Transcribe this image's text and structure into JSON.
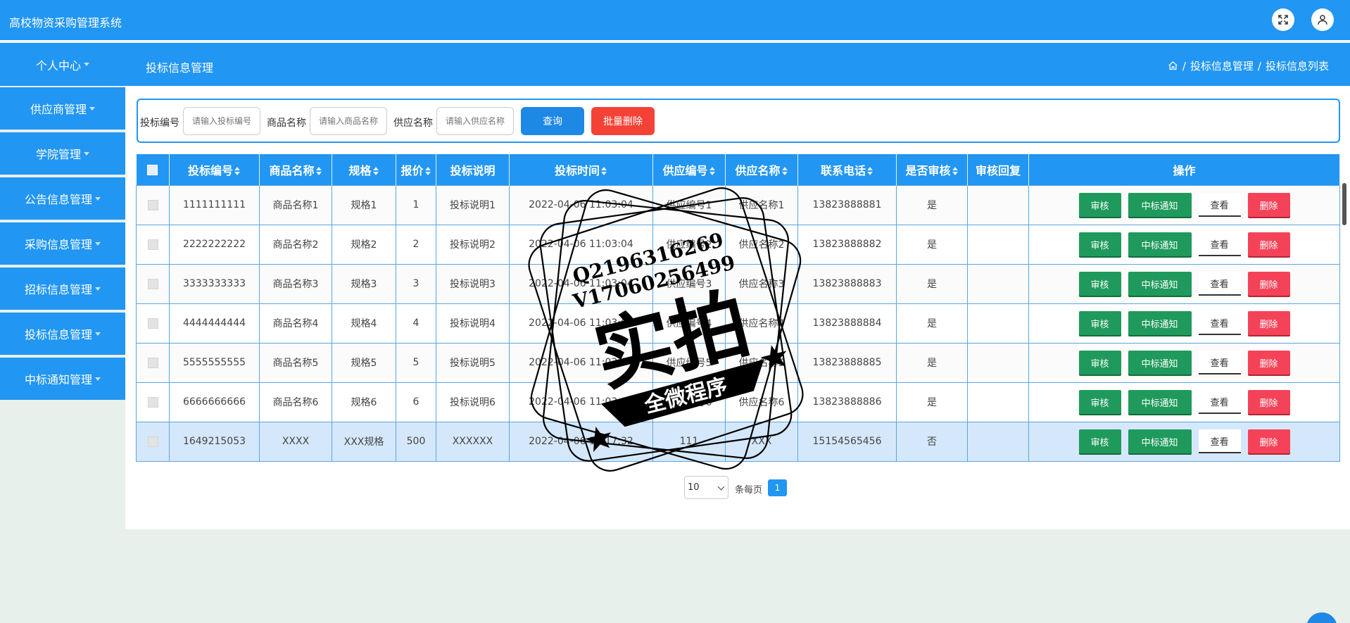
{
  "header": {
    "app_title": "高校物资采购管理系统"
  },
  "subheader": {
    "menu_head": "个人中心",
    "page_title": "投标信息管理",
    "breadcrumb": [
      "投标信息管理",
      "投标信息列表"
    ]
  },
  "sidebar": {
    "items": [
      {
        "label": "供应商管理"
      },
      {
        "label": "学院管理"
      },
      {
        "label": "公告信息管理"
      },
      {
        "label": "采购信息管理"
      },
      {
        "label": "招标信息管理"
      },
      {
        "label": "投标信息管理"
      },
      {
        "label": "中标通知管理"
      }
    ]
  },
  "search": {
    "bid_no_label": "投标编号",
    "bid_no_placeholder": "请输入投标编号",
    "product_label": "商品名称",
    "product_placeholder": "请输入商品名称",
    "supplier_label": "供应名称",
    "supplier_placeholder": "请输入供应名称",
    "query_button": "查询",
    "batch_delete_button": "批量删除"
  },
  "table": {
    "columns": [
      "投标编号",
      "商品名称",
      "规格",
      "报价",
      "投标说明",
      "投标时间",
      "供应编号",
      "供应名称",
      "联系电话",
      "是否审核",
      "审核回复",
      "操作"
    ],
    "actions": {
      "review": "审核",
      "notice": "中标通知",
      "view": "查看",
      "delete": "删除"
    },
    "rows": [
      {
        "bid_no": "1111111111",
        "product": "商品名称1",
        "spec": "规格1",
        "price": "1",
        "desc": "投标说明1",
        "time": "2022-04-06 11:03:04",
        "supplier_no": "供应编号1",
        "supplier": "供应名称1",
        "phone": "13823888881",
        "reviewed": "是",
        "reply": ""
      },
      {
        "bid_no": "2222222222",
        "product": "商品名称2",
        "spec": "规格2",
        "price": "2",
        "desc": "投标说明2",
        "time": "2022-04-06 11:03:04",
        "supplier_no": "供应编号2",
        "supplier": "供应名称2",
        "phone": "13823888882",
        "reviewed": "是",
        "reply": ""
      },
      {
        "bid_no": "3333333333",
        "product": "商品名称3",
        "spec": "规格3",
        "price": "3",
        "desc": "投标说明3",
        "time": "2022-04-06 11:03:04",
        "supplier_no": "供应编号3",
        "supplier": "供应名称3",
        "phone": "13823888883",
        "reviewed": "是",
        "reply": ""
      },
      {
        "bid_no": "4444444444",
        "product": "商品名称4",
        "spec": "规格4",
        "price": "4",
        "desc": "投标说明4",
        "time": "2022-04-06 11:03:04",
        "supplier_no": "供应编号4",
        "supplier": "供应名称4",
        "phone": "13823888884",
        "reviewed": "是",
        "reply": ""
      },
      {
        "bid_no": "5555555555",
        "product": "商品名称5",
        "spec": "规格5",
        "price": "5",
        "desc": "投标说明5",
        "time": "2022-04-06 11:03:04",
        "supplier_no": "供应编号5",
        "supplier": "供应名称5",
        "phone": "13823888885",
        "reviewed": "是",
        "reply": ""
      },
      {
        "bid_no": "6666666666",
        "product": "商品名称6",
        "spec": "规格6",
        "price": "6",
        "desc": "投标说明6",
        "time": "2022-04-06 11:03:04",
        "supplier_no": "供应编号6",
        "supplier": "供应名称6",
        "phone": "13823888886",
        "reviewed": "是",
        "reply": ""
      },
      {
        "bid_no": "1649215053",
        "product": "XXXX",
        "spec": "XXX规格",
        "price": "500",
        "desc": "XXXXXX",
        "time": "2022-04-06 11:17:32",
        "supplier_no": "111",
        "supplier": "XXX",
        "phone": "15154565456",
        "reviewed": "否",
        "reply": ""
      }
    ]
  },
  "pagination": {
    "page_size": "10",
    "per_page_label": "条每页",
    "current_page": "1"
  },
  "stamp": {
    "qq": "Q2196316269",
    "wechat": "V17060256499",
    "main_text": "实拍",
    "sub_text": "全微程序"
  },
  "colors": {
    "primary": "#2196f3",
    "danger": "#f44336",
    "success": "#1f9a5c",
    "background": "#e8f0ec"
  }
}
